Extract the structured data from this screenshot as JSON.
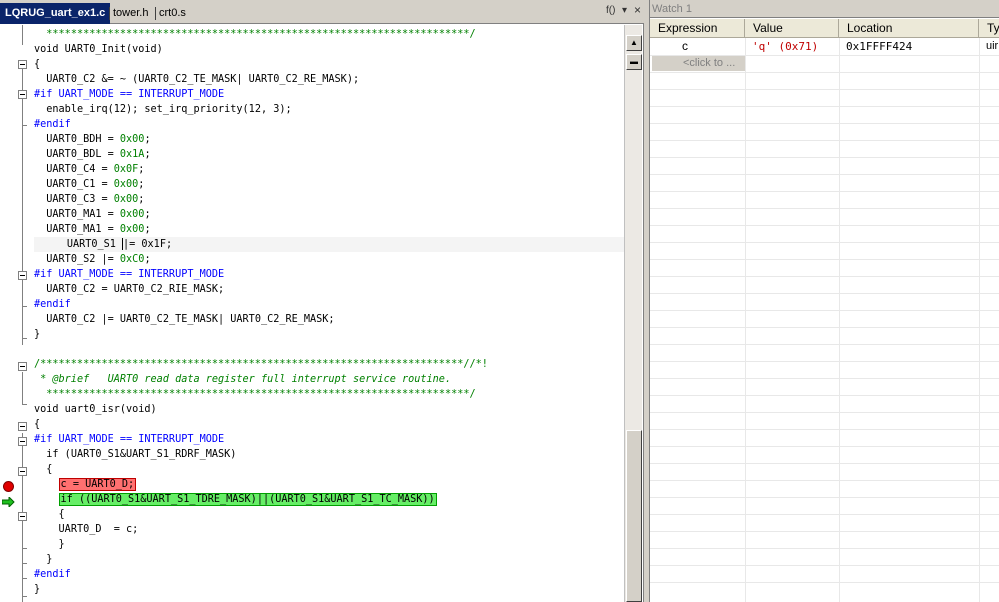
{
  "tabs": [
    {
      "label": "LQRUG_uart_ex1.c",
      "active": true
    },
    {
      "label": "tower.h",
      "active": false
    },
    {
      "label": "crt0.s",
      "active": false
    }
  ],
  "tab_controls": {
    "function_menu": "f()",
    "dropdown": "▾",
    "close": "×"
  },
  "code_lines": [
    {
      "text": "*********************************************************************/",
      "cls": "c-star",
      "indent": "  "
    },
    {
      "text": "void UART0_Init(void)",
      "cls": "",
      "indent": ""
    },
    {
      "text": "{",
      "cls": "",
      "indent": ""
    },
    {
      "text": "UART0_C2 &= ~ (UART0_C2_TE_MASK| UART0_C2_RE_MASK);",
      "cls": "",
      "indent": "  "
    },
    {
      "text": "#if UART_MODE == INTERRUPT_MODE",
      "cls": "c-pp",
      "indent": ""
    },
    {
      "text": "enable_irq(12); set_irq_priority(12, 3);",
      "cls": "",
      "indent": "  "
    },
    {
      "text": "#endif",
      "cls": "c-pp",
      "indent": ""
    },
    {
      "text": "UART0_BDH = 0x00;",
      "cls": "",
      "indent": "  "
    },
    {
      "text": "UART0_BDL = 0x1A;",
      "cls": "",
      "indent": "  "
    },
    {
      "text": "UART0_C4 = 0x0F;",
      "cls": "",
      "indent": "  "
    },
    {
      "text": "UART0_C1 = 0x00;",
      "cls": "",
      "indent": "  "
    },
    {
      "text": "UART0_C3 = 0x00;",
      "cls": "",
      "indent": "  "
    },
    {
      "text": "UART0_MA1 = 0x00;",
      "cls": "",
      "indent": "  "
    },
    {
      "text": "UART0_MA1 = 0x00;",
      "cls": "",
      "indent": "  "
    },
    {
      "text": "UART0_S1 |= 0x1F;",
      "cls": "",
      "indent": "  "
    },
    {
      "text": "UART0_S2 |= 0xC0;",
      "cls": "",
      "indent": "  "
    },
    {
      "text": "#if UART_MODE == INTERRUPT_MODE",
      "cls": "c-pp",
      "indent": ""
    },
    {
      "text": "UART0_C2 = UART0_C2_RIE_MASK;",
      "cls": "",
      "indent": "  "
    },
    {
      "text": "#endif",
      "cls": "c-pp",
      "indent": ""
    },
    {
      "text": "UART0_C2 |= UART0_C2_TE_MASK| UART0_C2_RE_MASK;",
      "cls": "",
      "indent": "  "
    },
    {
      "text": "}",
      "cls": "",
      "indent": ""
    },
    {
      "text": "",
      "cls": "",
      "indent": ""
    },
    {
      "text": "/*********************************************************************//*!",
      "cls": "c-star",
      "indent": ""
    },
    {
      "text": "* @brief   UART0 read data register full interrupt service routine.",
      "cls": "c-com",
      "indent": " "
    },
    {
      "text": "*********************************************************************/",
      "cls": "c-star",
      "indent": "  "
    },
    {
      "text": "void uart0_isr(void)",
      "cls": "",
      "indent": ""
    },
    {
      "text": "{",
      "cls": "",
      "indent": ""
    },
    {
      "text": "#if UART_MODE == INTERRUPT_MODE",
      "cls": "c-pp",
      "indent": ""
    },
    {
      "text": "if (UART0_S1&UART_S1_RDRF_MASK)",
      "cls": "",
      "indent": "  "
    },
    {
      "text": "{",
      "cls": "",
      "indent": "  "
    },
    {
      "text": "c = UART0_D;",
      "cls": "hl-red",
      "indent": "    "
    },
    {
      "text": "if ((UART0_S1&UART_S1_TDRE_MASK)||(UART0_S1&UART_S1_TC_MASK))",
      "cls": "hl-green",
      "indent": "    "
    },
    {
      "text": "{",
      "cls": "",
      "indent": "    "
    },
    {
      "text": "UART0_D  = c;",
      "cls": "",
      "indent": "    "
    },
    {
      "text": "}",
      "cls": "",
      "indent": "    "
    },
    {
      "text": "}",
      "cls": "",
      "indent": "  "
    },
    {
      "text": "#endif",
      "cls": "c-pp",
      "indent": ""
    },
    {
      "text": "}",
      "cls": "",
      "indent": ""
    }
  ],
  "watch": {
    "title": "Watch 1",
    "columns": [
      "Expression",
      "Value",
      "Location",
      "Ty"
    ],
    "rows": [
      {
        "expression": "c",
        "value": "'q' (0x71)",
        "location": "0x1FFFF424",
        "type": "uir"
      }
    ],
    "add_placeholder": "<click to ..."
  },
  "colors": {
    "value_changed": "#c00000",
    "active_tab": "#0a246a"
  }
}
